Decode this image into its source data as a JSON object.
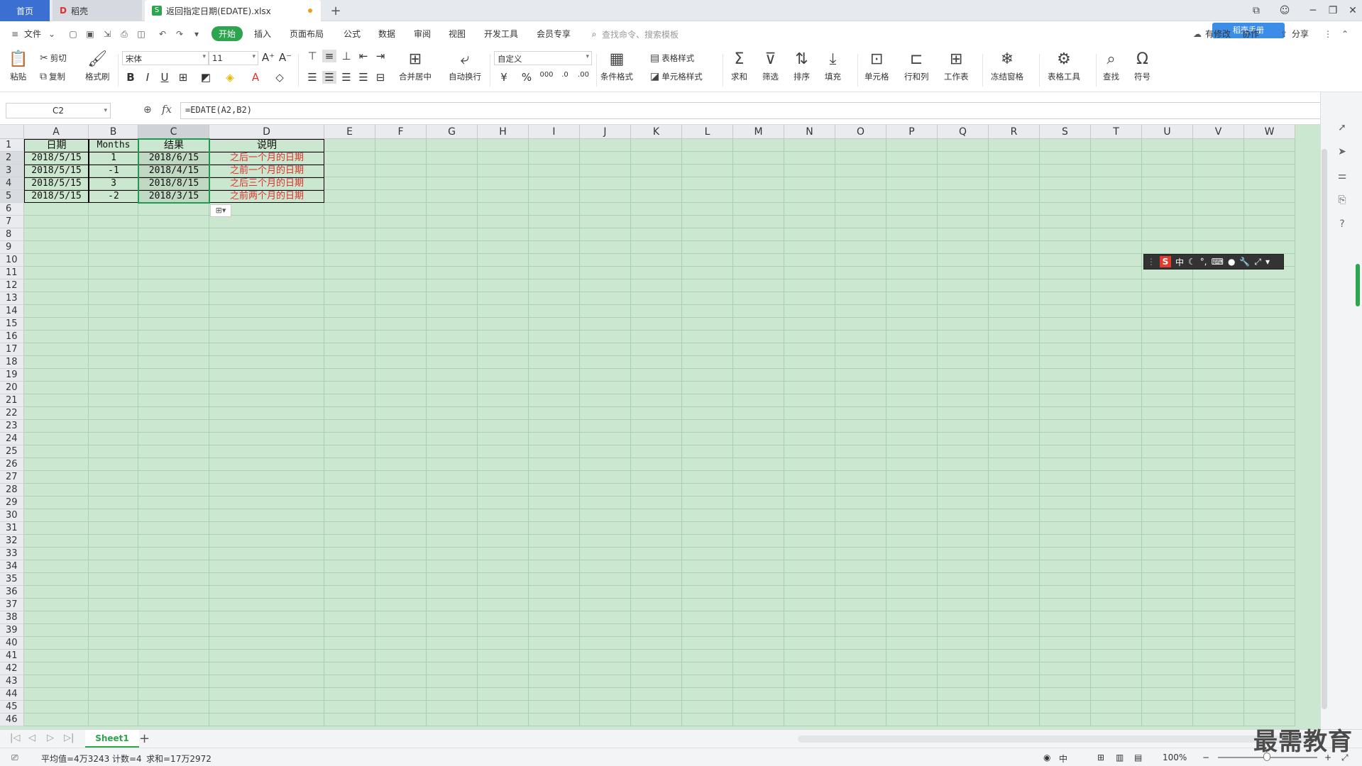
{
  "tabs": {
    "home": "首页",
    "docer": "稻壳",
    "file": "返回指定日期(EDATE).xlsx",
    "add": "+"
  },
  "menu": {
    "file": "文件",
    "items": [
      "开始",
      "插入",
      "页面布局",
      "公式",
      "数据",
      "审阅",
      "视图",
      "开发工具",
      "会员专享"
    ],
    "search_placeholder": "查找命令、搜索模板",
    "sync": "有修改",
    "collab": "协作",
    "share": "分享",
    "badge": "稻壳手册"
  },
  "ribbon": {
    "paste": "粘贴",
    "cut": "剪切",
    "copy": "复制",
    "format_painter": "格式刷",
    "font_name": "宋体",
    "font_size": "11",
    "merge_center": "合并居中",
    "wrap_text": "自动换行",
    "number_format": "自定义",
    "table_style": "表格样式",
    "cond_format": "条件格式",
    "cell_style": "单元格样式",
    "sum": "求和",
    "filter": "筛选",
    "sort": "排序",
    "fill": "填充",
    "cell": "单元格",
    "row_col": "行和列",
    "worksheet": "工作表",
    "freeze": "冻结窗格",
    "table_tools": "表格工具",
    "find": "查找",
    "symbol": "符号"
  },
  "formula_bar": {
    "name_box": "C2",
    "formula": "=EDATE(A2,B2)"
  },
  "grid": {
    "columns": [
      "A",
      "B",
      "C",
      "D",
      "E",
      "F",
      "G",
      "H",
      "I",
      "J",
      "K",
      "L",
      "M",
      "N",
      "O",
      "P",
      "Q",
      "R",
      "S",
      "T",
      "U",
      "V",
      "W"
    ],
    "row_count": 46,
    "headers": [
      "日期",
      "Months",
      "结果",
      "说明"
    ],
    "rows": [
      [
        "2018/5/15",
        "1",
        "2018/6/15",
        "之后一个月的日期"
      ],
      [
        "2018/5/15",
        "-1",
        "2018/4/15",
        "之前一个月的日期"
      ],
      [
        "2018/5/15",
        "3",
        "2018/8/15",
        "之后三个月的日期"
      ],
      [
        "2018/5/15",
        "-2",
        "2018/3/15",
        "之前两个月的日期"
      ]
    ]
  },
  "ime": {
    "lang": "中"
  },
  "sheets": {
    "active": "Sheet1"
  },
  "status": {
    "average": "平均值=4万3243",
    "count": "计数=4",
    "sum": "求和=17万2972",
    "zoom": "100%",
    "ime_lang": "中"
  },
  "watermark": "最需教育",
  "colors": {
    "sheet_bg": "#cce7cf",
    "accent": "#2da44e",
    "red_text": "#e0302a",
    "home_tab": "#3b6fd1"
  }
}
